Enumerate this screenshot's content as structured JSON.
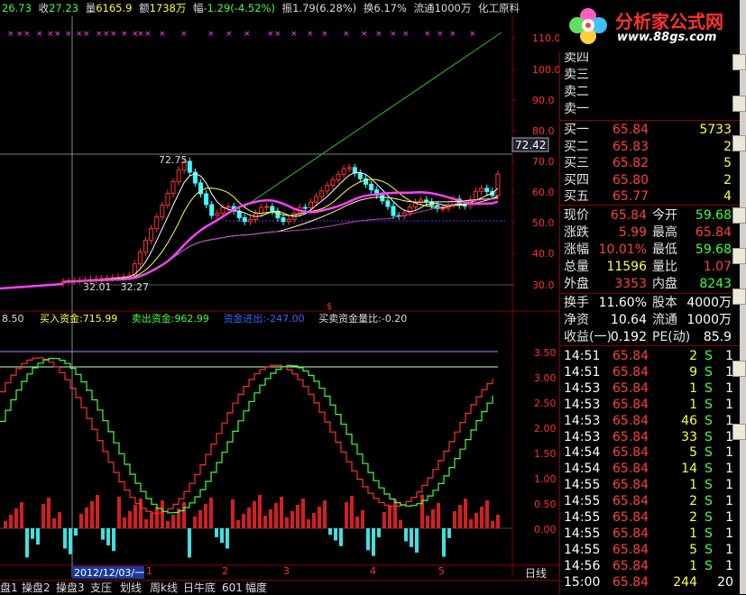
{
  "header": {
    "open_val": "26.73",
    "close_label": "收",
    "close_val": "27.23",
    "vol_label": "量",
    "vol_val": "6165.9",
    "amt_label": "额",
    "amt_val": "1738万",
    "chg_label": "幅",
    "chg_val": "-1.29(-4.52%)",
    "amp_label": "振",
    "amp_val": "1.79(6.28%)",
    "turn_label": "换",
    "turn_val": "6.17%",
    "float_label": "流通",
    "float_val": "1000万",
    "industry": "化工原料"
  },
  "price_axis": [
    "110.0",
    "100.0",
    "90.0",
    "80.0",
    "70.0",
    "60.0",
    "50.0",
    "40.0",
    "30.0"
  ],
  "price_marker": "72.42",
  "annotations": {
    "high": "72.75",
    "low_left": "32.01",
    "low_right": "32.27"
  },
  "indicator": {
    "left_val": "8.50",
    "buy_label": "买入资金:",
    "buy_val": "715.99",
    "sell_label": "卖出资金:",
    "sell_val": "962.99",
    "net_label": "资金进出:",
    "net_val": "-247.00",
    "ratio_label": "买卖资金量比:",
    "ratio_val": "-0.20"
  },
  "indicator_axis": [
    "3.50",
    "3.00",
    "2.50",
    "2.00",
    "1.50",
    "1.00",
    "0.50",
    "0.00"
  ],
  "date_axis": {
    "date": "2012/12/03/一",
    "months": [
      "1",
      "2",
      "3",
      "4",
      "5"
    ],
    "period": "日线"
  },
  "tabs": [
    "盘1",
    "操盘2",
    "操盘3",
    "支压",
    "划线",
    "周k线",
    "日牛底",
    "601",
    "幅度"
  ],
  "logo": {
    "title": "分析家公式网",
    "url": "www.88gs.com"
  },
  "order_book": {
    "asks": [
      {
        "label": "卖四",
        "price": "",
        "vol": ""
      },
      {
        "label": "卖三",
        "price": "",
        "vol": ""
      },
      {
        "label": "卖二",
        "price": "",
        "vol": ""
      },
      {
        "label": "卖一",
        "price": "",
        "vol": ""
      }
    ],
    "bids": [
      {
        "label": "买一",
        "price": "65.84",
        "vol": "5733"
      },
      {
        "label": "买二",
        "price": "65.83",
        "vol": "2"
      },
      {
        "label": "买三",
        "price": "65.82",
        "vol": "5"
      },
      {
        "label": "买四",
        "price": "65.80",
        "vol": "2"
      },
      {
        "label": "买五",
        "price": "65.77",
        "vol": "4"
      }
    ]
  },
  "stats": [
    {
      "l1": "现价",
      "v1": "65.84",
      "c1": "red",
      "l2": "今开",
      "v2": "59.68",
      "c2": "green"
    },
    {
      "l1": "涨跌",
      "v1": "5.99",
      "c1": "red",
      "l2": "最高",
      "v2": "65.84",
      "c2": "red"
    },
    {
      "l1": "涨幅",
      "v1": "10.01%",
      "c1": "red",
      "l2": "最低",
      "v2": "59.68",
      "c2": "green"
    },
    {
      "l1": "总量",
      "v1": "11596",
      "c1": "yellow",
      "l2": "量比",
      "v2": "1.07",
      "c2": "red"
    },
    {
      "l1": "外盘",
      "v1": "3353",
      "c1": "red",
      "l2": "内盘",
      "v2": "8243",
      "c2": "green"
    }
  ],
  "stats2": [
    {
      "l1": "换手",
      "v1": "11.60%",
      "c1": "white",
      "l2": "股本",
      "v2": "4000万",
      "c2": "white"
    },
    {
      "l1": "净资",
      "v1": "10.64",
      "c1": "white",
      "l2": "流通",
      "v2": "1000万",
      "c2": "white"
    },
    {
      "l1": "收益(一)",
      "v1": "0.192",
      "c1": "white",
      "l2": "PE(动)",
      "v2": "85.9",
      "c2": "white"
    }
  ],
  "ticks": [
    {
      "t": "14:51",
      "p": "65.84",
      "v": "2",
      "s": "S",
      "n": "1"
    },
    {
      "t": "14:51",
      "p": "65.84",
      "v": "9",
      "s": "S",
      "n": "1"
    },
    {
      "t": "14:53",
      "p": "65.84",
      "v": "1",
      "s": "S",
      "n": "1"
    },
    {
      "t": "14:53",
      "p": "65.84",
      "v": "1",
      "s": "S",
      "n": "1"
    },
    {
      "t": "14:53",
      "p": "65.84",
      "v": "46",
      "s": "S",
      "n": "1"
    },
    {
      "t": "14:53",
      "p": "65.84",
      "v": "33",
      "s": "S",
      "n": "1"
    },
    {
      "t": "14:54",
      "p": "65.84",
      "v": "5",
      "s": "S",
      "n": "1"
    },
    {
      "t": "14:54",
      "p": "65.84",
      "v": "14",
      "s": "S",
      "n": "1"
    },
    {
      "t": "14:55",
      "p": "65.84",
      "v": "1",
      "s": "S",
      "n": "1"
    },
    {
      "t": "14:55",
      "p": "65.84",
      "v": "2",
      "s": "S",
      "n": "1"
    },
    {
      "t": "14:55",
      "p": "65.84",
      "v": "2",
      "s": "S",
      "n": "1"
    },
    {
      "t": "14:55",
      "p": "65.84",
      "v": "1",
      "s": "S",
      "n": "1"
    },
    {
      "t": "14:55",
      "p": "65.84",
      "v": "5",
      "s": "S",
      "n": "1"
    },
    {
      "t": "14:56",
      "p": "65.84",
      "v": "1",
      "s": "S",
      "n": "1"
    },
    {
      "t": "15:00",
      "p": "65.84",
      "v": "244",
      "s": "",
      "n": "20"
    }
  ],
  "colors": {
    "up": "#ff3030",
    "down": "#30ff30",
    "grid": "#8a0000",
    "ma1": "#ffffff",
    "ma2": "#ffff40",
    "ma3": "#ff40ff",
    "cyan": "#40e0e0"
  }
}
